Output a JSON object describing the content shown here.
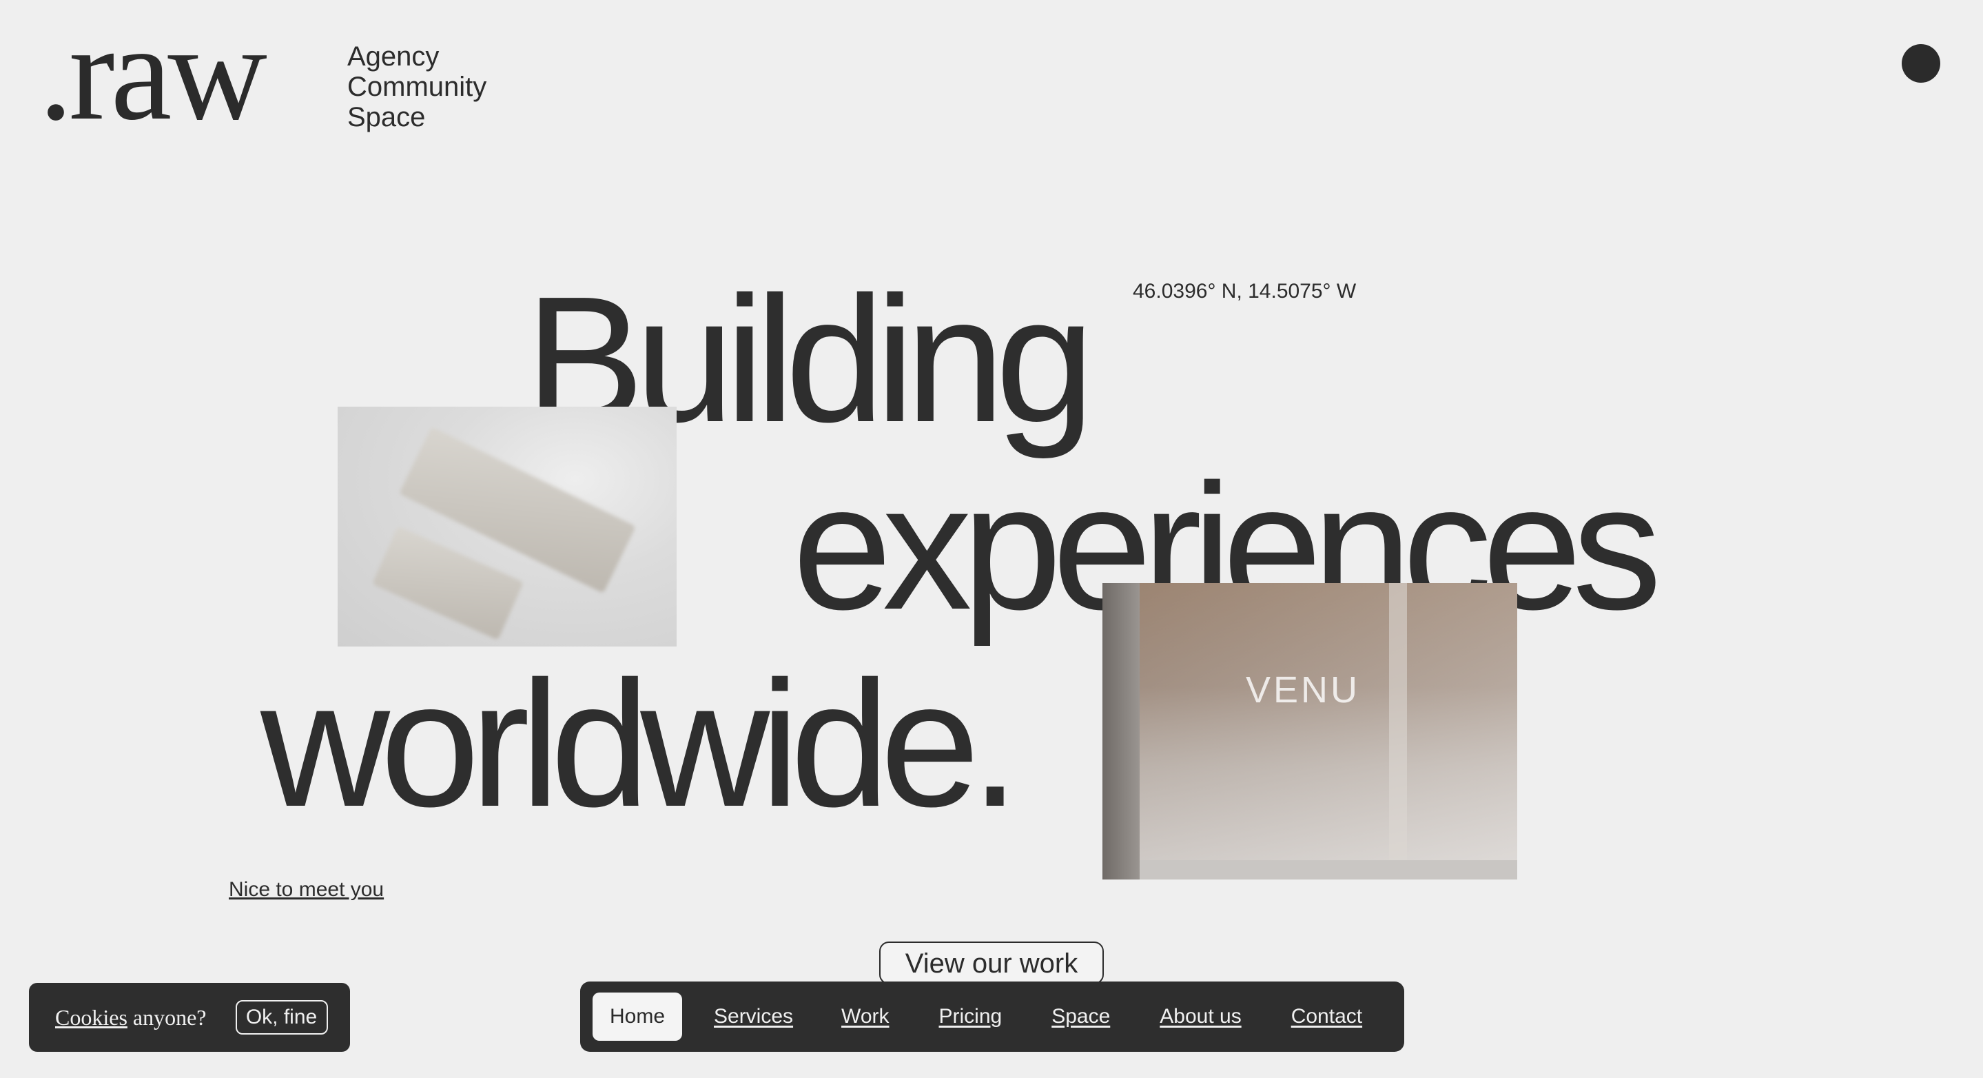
{
  "header": {
    "logo": ".raw",
    "tagline_title": "Agency",
    "tagline_paragraph": "Community Space"
  },
  "hero": {
    "line1": "Building",
    "line2": "experiences",
    "line3": "worldwide.",
    "coordinates": "46.0396° N, 14.5075° W",
    "meet_link": "Nice to meet you",
    "image_sign_text": "VENU"
  },
  "cta": {
    "label": "View our work"
  },
  "nav": {
    "items": [
      "Home",
      "Services",
      "Work",
      "Pricing",
      "Space",
      "About us",
      "Contact"
    ]
  },
  "cookie": {
    "word": "Cookies",
    "rest": " anyone?",
    "button": "Ok, fine"
  },
  "colors": {
    "background": "#efefef",
    "text": "#2c2c2c",
    "dark_panel": "#2e2e2e"
  },
  "icons": {
    "menu_toggle": "circle-icon"
  }
}
